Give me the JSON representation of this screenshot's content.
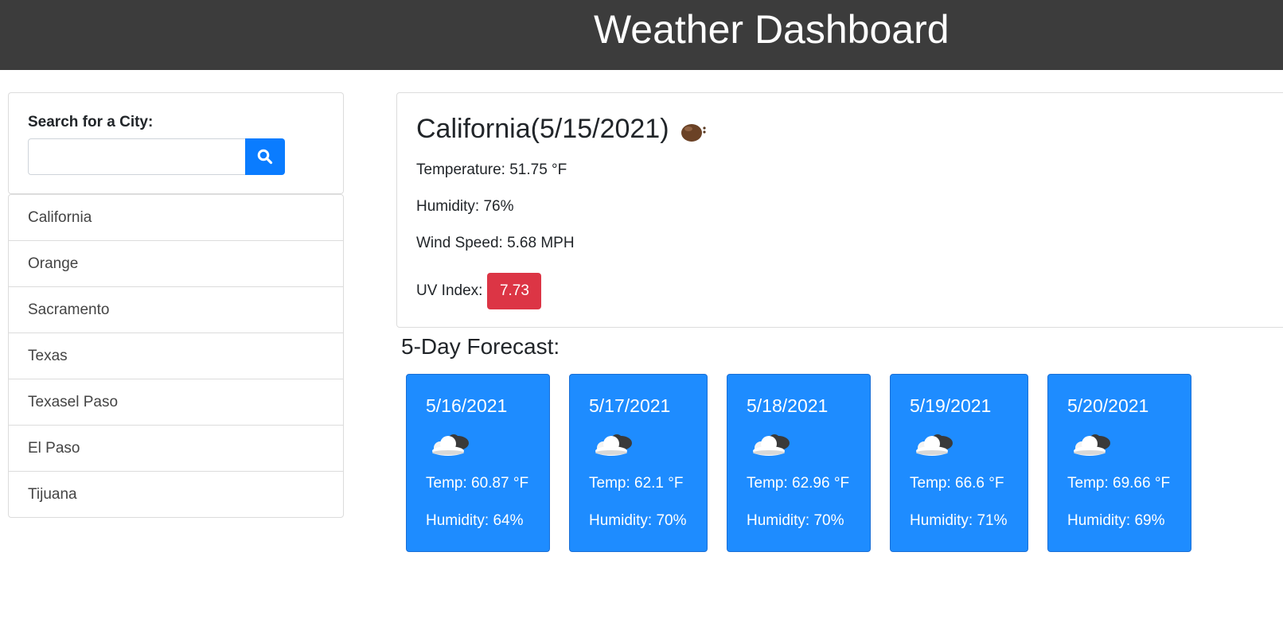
{
  "header": {
    "title": "Weather Dashboard"
  },
  "search": {
    "label": "Search for a City:",
    "value": "",
    "placeholder": "",
    "button_icon": "search-icon"
  },
  "history": [
    "California",
    "Orange",
    "Sacramento",
    "Texas",
    "Texasel Paso",
    "El Paso",
    "Tijuana"
  ],
  "current": {
    "title": "California(5/15/2021)",
    "icon": "weather-icon",
    "temperature": "Temperature: 51.75 °F",
    "humidity": "Humidity: 76%",
    "wind": "Wind Speed: 5.68 MPH",
    "uv_label": "UV Index:",
    "uv_value": "7.73",
    "uv_color": "#dc3545"
  },
  "forecast": {
    "heading": "5-Day Forecast:",
    "card_color": "#1e8cff",
    "days": [
      {
        "date": "5/16/2021",
        "icon": "partly-cloudy-icon",
        "temp": "Temp: 60.87 °F",
        "humidity": "Humidity: 64%"
      },
      {
        "date": "5/17/2021",
        "icon": "partly-cloudy-icon",
        "temp": "Temp: 62.1 °F",
        "humidity": "Humidity: 70%"
      },
      {
        "date": "5/18/2021",
        "icon": "partly-cloudy-icon",
        "temp": "Temp: 62.96 °F",
        "humidity": "Humidity: 70%"
      },
      {
        "date": "5/19/2021",
        "icon": "partly-cloudy-icon",
        "temp": "Temp: 66.6 °F",
        "humidity": "Humidity: 71%"
      },
      {
        "date": "5/20/2021",
        "icon": "partly-cloudy-icon",
        "temp": "Temp: 69.66 °F",
        "humidity": "Humidity: 69%"
      }
    ]
  }
}
